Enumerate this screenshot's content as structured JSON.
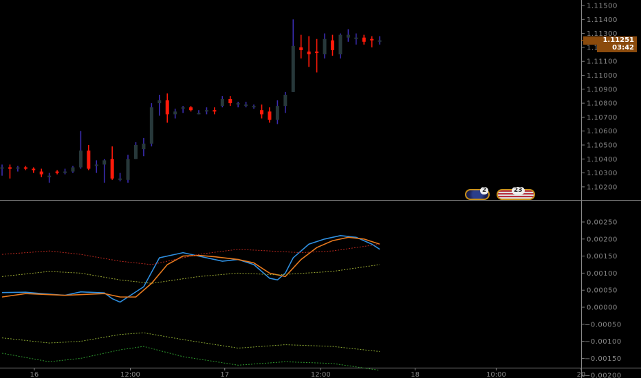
{
  "chart_data": [
    {
      "type": "candlestick",
      "pane": "price",
      "ylim": [
        1.1015,
        1.1154
      ],
      "yticks": [
        "1.11500",
        "1.11400",
        "1.11300",
        "1.11200",
        "1.11100",
        "1.11000",
        "1.10900",
        "1.10800",
        "1.10700",
        "1.10600",
        "1.10500",
        "1.10400",
        "1.10300",
        "1.10200"
      ],
      "current_price": "1.11251",
      "countdown": "03:42",
      "candles": [
        [
          1.1033,
          1.1036,
          1.1028,
          1.1034
        ],
        [
          1.1034,
          1.1036,
          1.1026,
          1.1033
        ],
        [
          1.1033,
          1.1035,
          1.1031,
          1.1034
        ],
        [
          1.1034,
          1.1035,
          1.1032,
          1.1033
        ],
        [
          1.1033,
          1.1034,
          1.103,
          1.1032
        ],
        [
          1.1031,
          1.1033,
          1.1027,
          1.1029
        ],
        [
          1.1028,
          1.103,
          1.1023,
          1.1028
        ],
        [
          1.1031,
          1.1032,
          1.1029,
          1.103
        ],
        [
          1.1031,
          1.1033,
          1.1029,
          1.1031
        ],
        [
          1.1031,
          1.1035,
          1.103,
          1.1034
        ],
        [
          1.1034,
          1.106,
          1.1033,
          1.1046
        ],
        [
          1.1046,
          1.105,
          1.1032,
          1.1033
        ],
        [
          1.1035,
          1.1039,
          1.103,
          1.1036
        ],
        [
          1.1036,
          1.104,
          1.1023,
          1.1039
        ],
        [
          1.104,
          1.1049,
          1.1025,
          1.1026
        ],
        [
          1.1026,
          1.103,
          1.1024,
          1.1026
        ],
        [
          1.1025,
          1.1043,
          1.1023,
          1.104
        ],
        [
          1.104,
          1.1052,
          1.104,
          1.105
        ],
        [
          1.1047,
          1.1055,
          1.1042,
          1.1051
        ],
        [
          1.1051,
          1.108,
          1.1049,
          1.1077
        ],
        [
          1.108,
          1.1086,
          1.1071,
          1.1082
        ],
        [
          1.1082,
          1.1087,
          1.1066,
          1.1072
        ],
        [
          1.1072,
          1.1076,
          1.1069,
          1.1074
        ],
        [
          1.1076,
          1.1078,
          1.1073,
          1.1077
        ],
        [
          1.1077,
          1.1078,
          1.1074,
          1.1075
        ],
        [
          1.1073,
          1.1075,
          1.1072,
          1.1073
        ],
        [
          1.1074,
          1.1077,
          1.1072,
          1.1075
        ],
        [
          1.1075,
          1.1077,
          1.1072,
          1.1074
        ],
        [
          1.1078,
          1.1085,
          1.1077,
          1.1083
        ],
        [
          1.1083,
          1.1085,
          1.1078,
          1.108
        ],
        [
          1.1079,
          1.1081,
          1.1077,
          1.108
        ],
        [
          1.1079,
          1.1081,
          1.1077,
          1.1079
        ],
        [
          1.1078,
          1.1079,
          1.1076,
          1.1078
        ],
        [
          1.1075,
          1.1079,
          1.1069,
          1.1072
        ],
        [
          1.1074,
          1.1077,
          1.1066,
          1.1068
        ],
        [
          1.1068,
          1.1082,
          1.1065,
          1.1078
        ],
        [
          1.1078,
          1.1088,
          1.1073,
          1.1086
        ],
        [
          1.1088,
          1.114,
          1.1088,
          1.1121
        ],
        [
          1.112,
          1.1129,
          1.1112,
          1.1118
        ],
        [
          1.1117,
          1.1128,
          1.1106,
          1.1115
        ],
        [
          1.1117,
          1.1126,
          1.1102,
          1.1116
        ],
        [
          1.1115,
          1.113,
          1.1112,
          1.1126
        ],
        [
          1.1125,
          1.1129,
          1.1114,
          1.1118
        ],
        [
          1.1115,
          1.113,
          1.1112,
          1.1129
        ],
        [
          1.1127,
          1.1133,
          1.1124,
          1.1129
        ],
        [
          1.1126,
          1.113,
          1.1122,
          1.1127
        ],
        [
          1.1127,
          1.1129,
          1.1122,
          1.1124
        ],
        [
          1.1126,
          1.1128,
          1.112,
          1.1125
        ],
        [
          1.1125,
          1.1128,
          1.1122,
          1.1125
        ]
      ],
      "bull_color": "#27383a",
      "bear_color": "#ff1a0a",
      "wick_color": "#3a2cb0"
    },
    {
      "type": "line",
      "pane": "indicator",
      "ylim": [
        -0.00228,
        0.00262
      ],
      "yticks": [
        "0.00250",
        "0.00200",
        "0.00150",
        "0.00100",
        "0.00050",
        "0.00000",
        "−0.00050",
        "−0.00100",
        "−0.00150",
        "−0.00200"
      ],
      "series": [
        {
          "name": "main",
          "color": "#2f8fe0",
          "style": "solid",
          "x": [
            0,
            3,
            5,
            8,
            10,
            13,
            14,
            15,
            16,
            18,
            20,
            22,
            23,
            25,
            27,
            28,
            30,
            32,
            34,
            35,
            36,
            37,
            39,
            41,
            43,
            45,
            47,
            48
          ],
          "y": [
            0.00043,
            0.00044,
            0.0004,
            0.00035,
            0.00045,
            0.00042,
            0.00025,
            0.00015,
            0.0003,
            0.0006,
            0.00145,
            0.00155,
            0.0016,
            0.0015,
            0.0014,
            0.00135,
            0.0014,
            0.00125,
            0.00085,
            0.0008,
            0.001,
            0.00145,
            0.00185,
            0.002,
            0.0021,
            0.00205,
            0.00185,
            0.0017
          ]
        },
        {
          "name": "signal",
          "color": "#e87a1e",
          "style": "solid",
          "x": [
            0,
            3,
            8,
            13,
            15,
            17,
            19,
            21,
            23,
            25,
            27,
            30,
            32,
            34,
            36,
            38,
            40,
            42,
            44,
            46,
            48
          ],
          "y": [
            0.0003,
            0.0004,
            0.00035,
            0.0004,
            0.0003,
            0.0003,
            0.0007,
            0.00125,
            0.0015,
            0.00152,
            0.00148,
            0.0014,
            0.0013,
            0.001,
            0.0009,
            0.0014,
            0.00175,
            0.00195,
            0.00205,
            0.002,
            0.00185
          ]
        },
        {
          "name": "upper-band",
          "color": "#b8281e",
          "style": "dotted",
          "x": [
            0,
            6,
            10,
            15,
            19,
            25,
            30,
            34,
            38,
            42,
            48
          ],
          "y": [
            0.00155,
            0.00165,
            0.00155,
            0.00135,
            0.00125,
            0.00155,
            0.0017,
            0.00165,
            0.0016,
            0.00165,
            0.00185
          ]
        },
        {
          "name": "upper-mid",
          "color": "#9aa832",
          "style": "dotted",
          "x": [
            0,
            6,
            10,
            15,
            19,
            25,
            30,
            35,
            42,
            48
          ],
          "y": [
            0.0009,
            0.00105,
            0.001,
            0.0008,
            0.0007,
            0.0009,
            0.001,
            0.00095,
            0.00105,
            0.00125
          ]
        },
        {
          "name": "lower-mid",
          "color": "#8aa832",
          "style": "dotted",
          "x": [
            0,
            6,
            10,
            15,
            18,
            23,
            30,
            36,
            42,
            48
          ],
          "y": [
            -0.0009,
            -0.00105,
            -0.001,
            -0.0008,
            -0.00075,
            -0.00095,
            -0.0012,
            -0.0011,
            -0.00115,
            -0.0013
          ]
        },
        {
          "name": "lower-band",
          "color": "#2e9a2e",
          "style": "dotted",
          "x": [
            0,
            6,
            10,
            15,
            18,
            23,
            30,
            36,
            42,
            48
          ],
          "y": [
            -0.00135,
            -0.0016,
            -0.0015,
            -0.00125,
            -0.00115,
            -0.00145,
            -0.0017,
            -0.0016,
            -0.00165,
            -0.00185
          ]
        }
      ]
    }
  ],
  "time_axis": [
    {
      "label": "16",
      "at": 4.1
    },
    {
      "label": "12:00",
      "at": 16.3
    },
    {
      "label": "17",
      "at": 28.3
    },
    {
      "label": "12:00",
      "at": 40.5
    },
    {
      "label": "18",
      "at": 52.5
    },
    {
      "label": "10:00",
      "at": 62.8
    },
    {
      "label": "20",
      "at": 73.6
    }
  ],
  "events": [
    {
      "name": "eu-flag",
      "count": "2"
    },
    {
      "name": "us-flag",
      "count": "23"
    }
  ]
}
